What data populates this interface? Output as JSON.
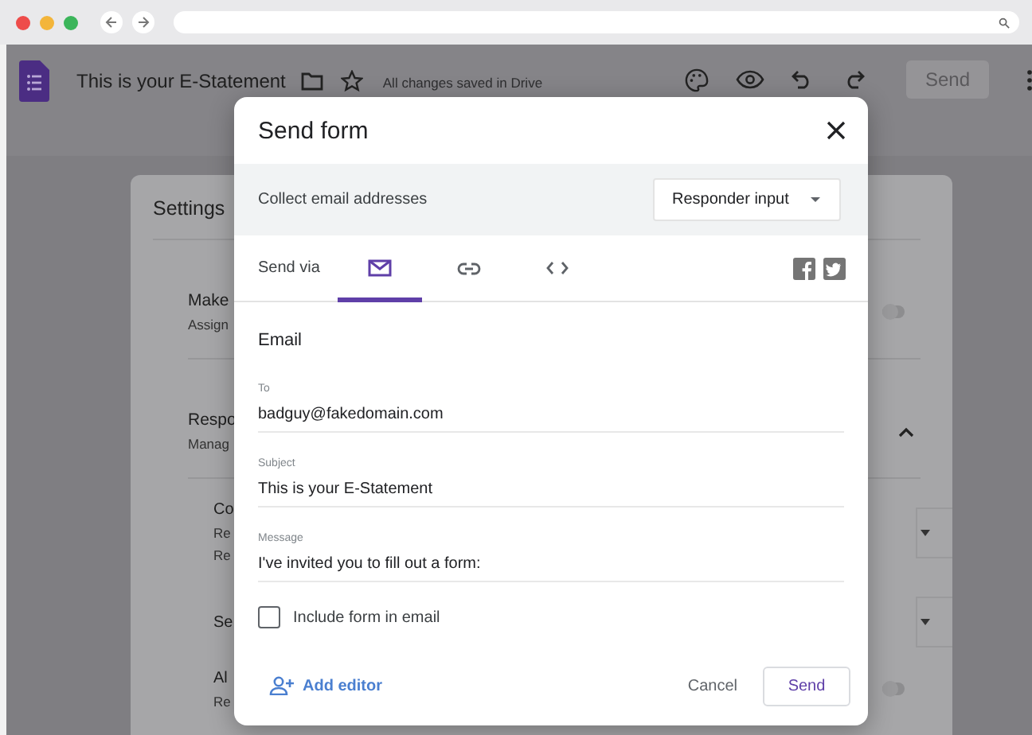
{
  "app_header": {
    "title": "This is your E-Statement",
    "save_status": "All changes saved in Drive",
    "send_button": {
      "label": "Send",
      "disabled": true
    }
  },
  "settings_panel": {
    "title": "Settings",
    "rows": [
      {
        "kind": "toggle",
        "title": "Make",
        "subtitle": [
          "Assign"
        ],
        "on": false
      },
      {
        "kind": "section",
        "title": "Respo",
        "subtitle": [
          "Manag"
        ],
        "expanded": true
      },
      {
        "kind": "dropdown",
        "title": "Co",
        "subtitle": [
          "Re",
          "Re"
        ]
      },
      {
        "kind": "dropdown",
        "title": "Se",
        "subtitle": []
      },
      {
        "kind": "toggle",
        "title": "Al",
        "subtitle": [
          "Re"
        ],
        "on": false
      }
    ]
  },
  "dialog": {
    "title": "Send form",
    "collect_email": {
      "label": "Collect email addresses",
      "dropdown": "Responder input"
    },
    "send_via": {
      "label": "Send via",
      "tabs": [
        {
          "kind": "email",
          "selected": true
        },
        {
          "kind": "link",
          "selected": false
        },
        {
          "kind": "embed",
          "selected": false
        }
      ]
    },
    "section_title": "Email",
    "fields": [
      {
        "label": "To",
        "value": "badguy@fakedomain.com"
      },
      {
        "label": "Subject",
        "value": "This is your E-Statement"
      },
      {
        "label": "Message",
        "value": "I've invited you to fill out a form:"
      }
    ],
    "include_form": {
      "label": "Include form in email",
      "checked": false
    },
    "add_editor": "Add editor",
    "buttons": [
      {
        "kind": "text",
        "label": "Cancel"
      },
      {
        "kind": "outlined",
        "label": "Send"
      }
    ]
  }
}
